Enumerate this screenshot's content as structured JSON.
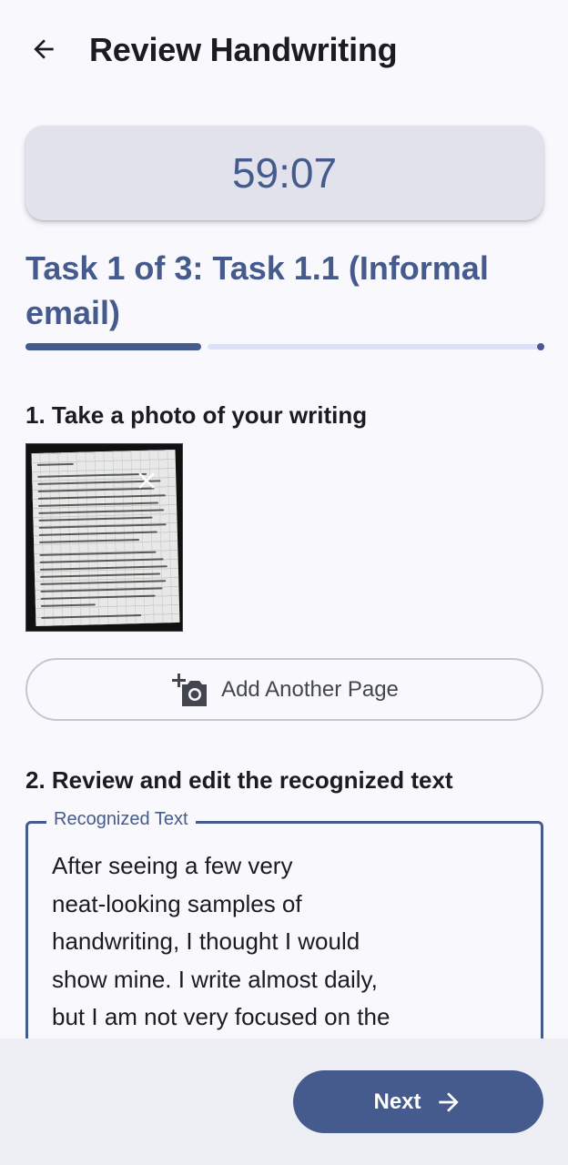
{
  "header": {
    "title": "Review Handwriting",
    "back_icon": "arrow-back-icon"
  },
  "timer": {
    "value": "59:07"
  },
  "task": {
    "title": "Task 1 of 3: Task 1.1 (Informal email)",
    "progress_fraction": 0.33
  },
  "step1": {
    "label": "1. Take a photo of your writing",
    "remove_icon": "close-icon",
    "add_page_label": "Add Another Page",
    "add_page_icon": "add-photo-camera-icon"
  },
  "step2": {
    "label": "2. Review and edit the recognized text",
    "field_label": "Recognized Text",
    "field_value": "After seeing a few very\nneat-looking samples of\nhandwriting, I thought I would\nshow mine. I write almost daily,\nbut I am not very focused on the"
  },
  "footer": {
    "next_label": "Next",
    "next_icon": "arrow-forward-icon"
  },
  "colors": {
    "primary": "#465b8d",
    "timer_card": "#e2e2ec",
    "background": "#f8f8fd"
  }
}
